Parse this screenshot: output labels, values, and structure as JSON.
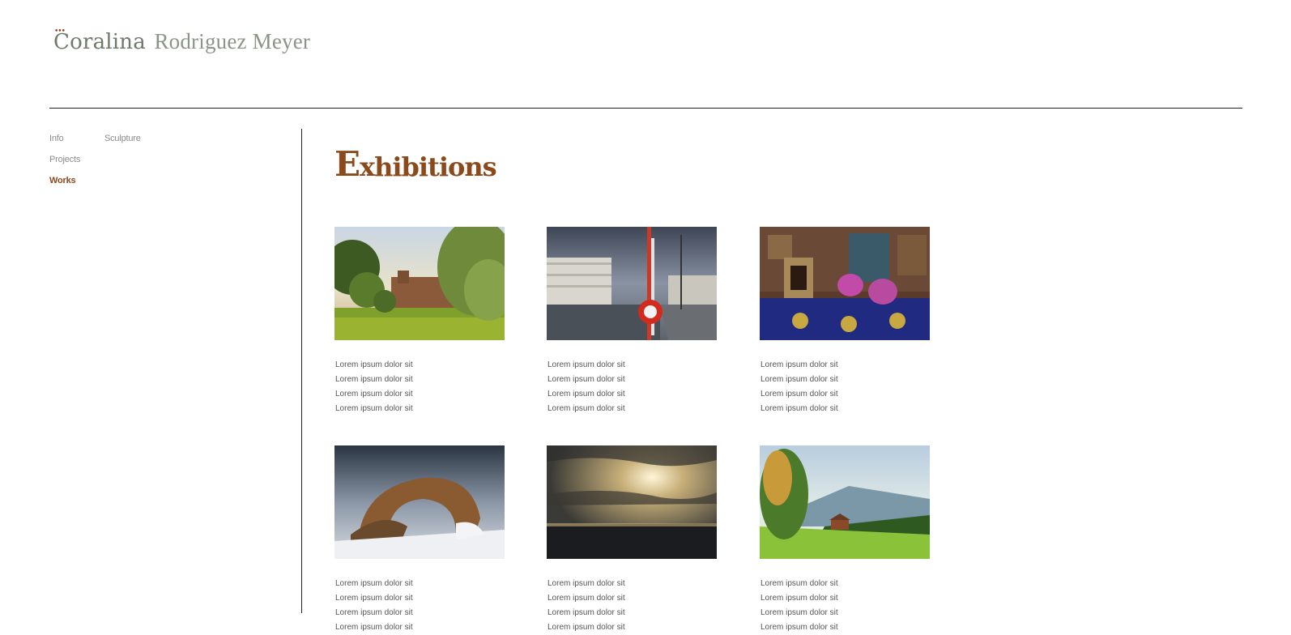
{
  "header": {
    "first_name": "Coralina",
    "last_name": "Rodriguez Meyer",
    "dots": "•••"
  },
  "nav": {
    "primary": [
      {
        "label": "Info",
        "active": false
      },
      {
        "label": "Projects",
        "active": false
      },
      {
        "label": "Works",
        "active": true
      }
    ],
    "secondary": [
      {
        "label": "Sculpture"
      }
    ]
  },
  "main": {
    "title": "Exhibitions",
    "items": [
      {
        "image": "park-with-old-building",
        "lines": [
          "Lorem ipsum dolor sit",
          "Lorem ipsum dolor sit",
          "Lorem ipsum dolor sit",
          "Lorem ipsum dolor sit"
        ]
      },
      {
        "image": "city-canal-with-lifebuoy",
        "lines": [
          "Lorem ipsum dolor sit",
          "Lorem ipsum dolor sit",
          "Lorem ipsum dolor sit",
          "Lorem ipsum dolor sit"
        ]
      },
      {
        "image": "ornate-palace-interior",
        "lines": [
          "Lorem ipsum dolor sit",
          "Lorem ipsum dolor sit",
          "Lorem ipsum dolor sit",
          "Lorem ipsum dolor sit"
        ]
      },
      {
        "image": "snowy-rock-arch",
        "lines": [
          "Lorem ipsum dolor sit",
          "Lorem ipsum dolor sit",
          "Lorem ipsum dolor sit",
          "Lorem ipsum dolor sit"
        ]
      },
      {
        "image": "sunrays-over-sea",
        "lines": [
          "Lorem ipsum dolor sit",
          "Lorem ipsum dolor sit",
          "Lorem ipsum dolor sit",
          "Lorem ipsum dolor sit"
        ]
      },
      {
        "image": "alpine-meadow-chalet",
        "lines": [
          "Lorem ipsum dolor sit",
          "Lorem ipsum dolor sit",
          "Lorem ipsum dolor sit",
          "Lorem ipsum dolor sit"
        ]
      }
    ]
  },
  "colors": {
    "accent": "#8b4a1b",
    "logo": "#7b8578",
    "nav": "#8b8b8b",
    "rule": "#222222",
    "text": "#555555"
  }
}
